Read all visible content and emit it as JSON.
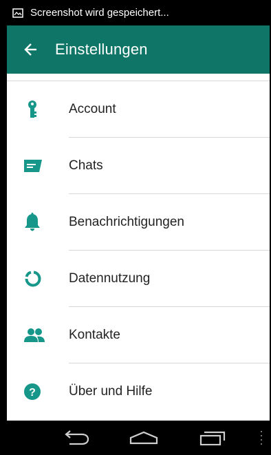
{
  "status_bar": {
    "notification_text": "Screenshot wird gespeichert..."
  },
  "app_bar": {
    "title": "Einstellungen",
    "color": "#0f7667"
  },
  "settings": {
    "items": [
      {
        "label": "Account",
        "icon": "key-icon"
      },
      {
        "label": "Chats",
        "icon": "chat-icon"
      },
      {
        "label": "Benachrichtigungen",
        "icon": "bell-icon"
      },
      {
        "label": "Datennutzung",
        "icon": "data-usage-icon"
      },
      {
        "label": "Kontakte",
        "icon": "contacts-icon"
      },
      {
        "label": "Über und Hilfe",
        "icon": "help-icon"
      }
    ]
  },
  "colors": {
    "accent": "#0f7667",
    "icon": "#16978a"
  },
  "nav_bar": {
    "buttons": [
      "back-icon",
      "home-icon",
      "recent-apps-icon"
    ]
  }
}
